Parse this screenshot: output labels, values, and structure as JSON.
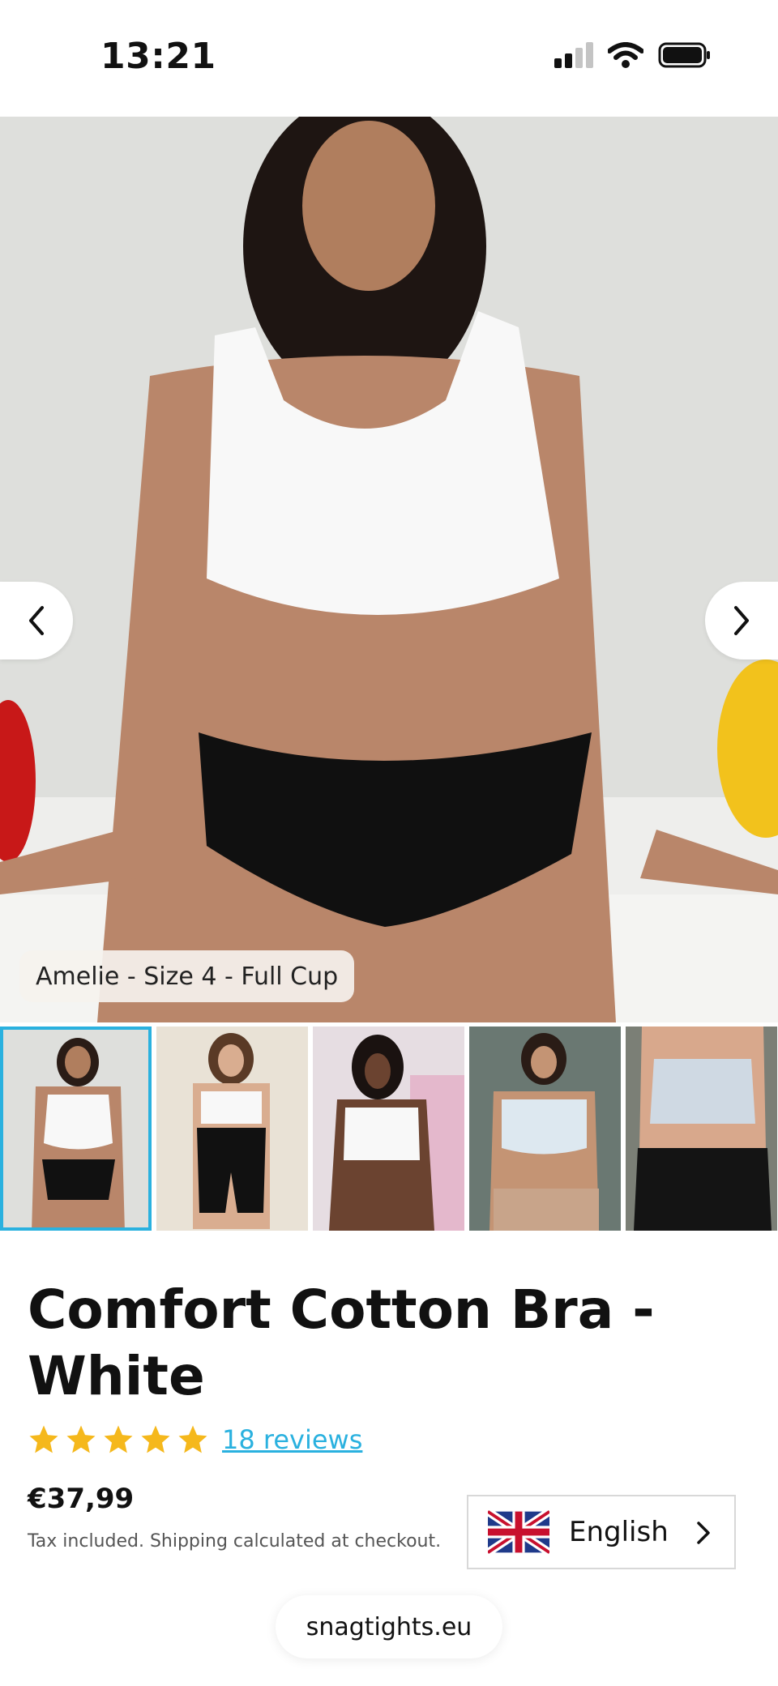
{
  "status": {
    "time": "13:21"
  },
  "gallery": {
    "caption": "Amelie - Size 4 - Full Cup",
    "prev_icon": "chevron-left-icon",
    "next_icon": "chevron-right-icon",
    "active_thumb": 0,
    "thumb_count": 5
  },
  "product": {
    "title": "Comfort Cotton Bra - White",
    "rating_stars": 5,
    "reviews_label": "18 reviews",
    "price": "€37,99",
    "tax_note": "Tax included. Shipping calculated at checkout."
  },
  "language": {
    "label": "English",
    "flag_icon": "uk-flag-icon"
  },
  "browser": {
    "url": "snagtights.eu"
  },
  "colors": {
    "accent": "#2ab1df",
    "star": "#f5b81c"
  }
}
